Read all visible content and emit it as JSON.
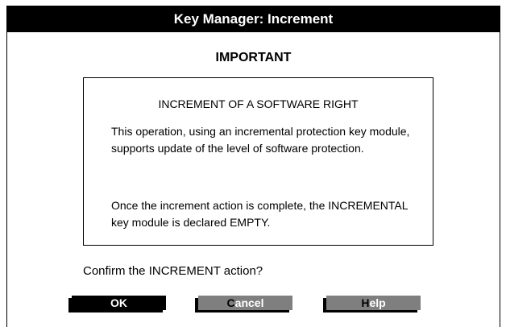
{
  "window": {
    "title": "Key Manager: Increment"
  },
  "heading": "IMPORTANT",
  "info": {
    "title": "INCREMENT OF A SOFTWARE RIGHT",
    "paragraph1": "This operation, using an incremental protection key module, supports update of the level of software protection.",
    "paragraph2": "Once the increment action is complete, the INCREMENTAL key module is declared EMPTY."
  },
  "question": "Confirm the INCREMENT action?",
  "buttons": {
    "ok": "OK",
    "cancel_first": "C",
    "cancel_rest": "ancel",
    "help_first": "H",
    "help_rest": "elp"
  }
}
